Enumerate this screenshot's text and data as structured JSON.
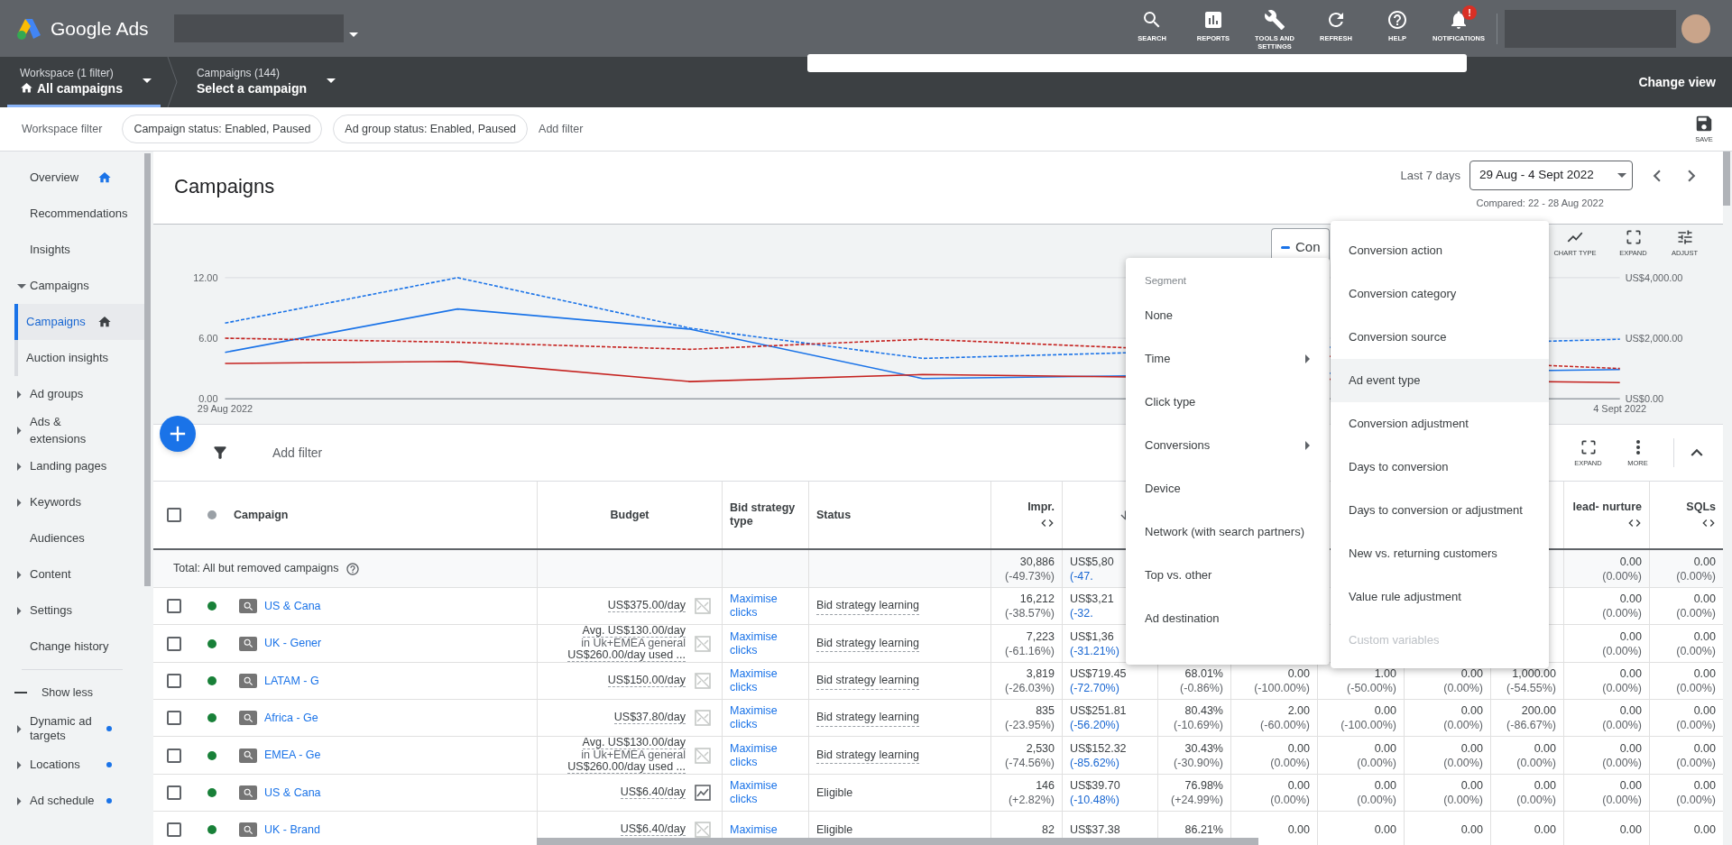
{
  "app": {
    "title": "Google Ads"
  },
  "top_actions": [
    {
      "label": "SEARCH",
      "kind": "search"
    },
    {
      "label": "REPORTS",
      "kind": "reports"
    },
    {
      "label": "TOOLS AND SETTINGS",
      "kind": "tools"
    },
    {
      "label": "REFRESH",
      "kind": "refresh"
    },
    {
      "label": "HELP",
      "kind": "help"
    },
    {
      "label": "NOTIFICATIONS",
      "kind": "notifications",
      "badge": "!"
    }
  ],
  "breadcrumbs": [
    {
      "caption": "Workspace (1 filter)",
      "title": "All campaigns",
      "home": true,
      "selected": true
    },
    {
      "caption": "Campaigns (144)",
      "title": "Select a campaign",
      "home": false,
      "selected": false
    }
  ],
  "change_view": "Change view",
  "filter_bar": {
    "label": "Workspace filter",
    "chips": [
      "Campaign status: Enabled, Paused",
      "Ad group status: Enabled, Paused"
    ],
    "add_filter": "Add filter",
    "save": "SAVE"
  },
  "sidebar": {
    "items": [
      {
        "label": "Overview",
        "home": true,
        "selected": false
      },
      {
        "label": "Recommendations",
        "selected": false
      },
      {
        "label": "Insights",
        "selected": false
      },
      {
        "label": "Campaigns",
        "expanded": true,
        "selected": false,
        "children": [
          {
            "label": "Campaigns",
            "home": true,
            "selected": true
          },
          {
            "label": "Auction insights",
            "selected": false
          }
        ]
      },
      {
        "label": "Ad groups",
        "expanded": false,
        "selected": false
      },
      {
        "label": "Ads & extensions",
        "expanded": false,
        "selected": false
      },
      {
        "label": "Landing pages",
        "expanded": false,
        "selected": false
      },
      {
        "label": "Keywords",
        "expanded": false,
        "selected": false
      },
      {
        "label": "Audiences",
        "selected": false
      },
      {
        "label": "Content",
        "expanded": false,
        "selected": false
      },
      {
        "label": "Settings",
        "expanded": false,
        "selected": false
      },
      {
        "label": "Change history",
        "selected": false
      }
    ],
    "show_less": "Show less",
    "more_items": [
      {
        "label": "Dynamic ad targets",
        "expanded": false,
        "dot": true
      },
      {
        "label": "Locations",
        "expanded": false,
        "dot": true
      },
      {
        "label": "Ad schedule",
        "expanded": false,
        "dot": true
      }
    ]
  },
  "page": {
    "title": "Campaigns",
    "range_label": "Last 7 days",
    "date_range": "29 Aug - 4 Sept 2022",
    "compared": "Compared: 22 - 28 Aug 2022"
  },
  "chart": {
    "legend_label": "Con",
    "tools": [
      {
        "label": "CHART TYPE",
        "kind": "chart_type"
      },
      {
        "label": "EXPAND",
        "kind": "expand"
      },
      {
        "label": "ADJUST",
        "kind": "adjust"
      }
    ],
    "right_axis_labels": [
      "US$4,000.00",
      "US$2,000.00",
      "US$0.00"
    ],
    "chart_data": {
      "type": "line",
      "categories": [
        "29 Aug 2022",
        null,
        null,
        null,
        null,
        null,
        "4 Sept 2022"
      ],
      "ylim": [
        0,
        12
      ],
      "yticks": [
        {
          "value": 0,
          "label": "0.00"
        },
        {
          "value": 6,
          "label": "6.00"
        },
        {
          "value": 12,
          "label": "12.00"
        }
      ],
      "series": [
        {
          "color": "#1a73e8",
          "line_style": "dashed",
          "values": [
            7.5,
            12,
            7.0,
            4.0,
            null,
            null,
            5.9
          ]
        },
        {
          "color": "#1a73e8",
          "line_style": "solid",
          "values": [
            4.6,
            8.9,
            6.9,
            2.0,
            null,
            null,
            2.9
          ]
        },
        {
          "color": "#c5221f",
          "line_style": "dashed",
          "values": [
            6.0,
            5.6,
            4.9,
            5.9,
            null,
            null,
            3.0
          ]
        },
        {
          "color": "#c5221f",
          "line_style": "solid",
          "values": [
            3.5,
            3.7,
            1.7,
            2.4,
            null,
            null,
            1.6
          ]
        }
      ]
    }
  },
  "table_toolbar": {
    "add_filter": "Add filter",
    "tools": [
      {
        "label": "EXPAND",
        "kind": "expand"
      },
      {
        "label": "MORE",
        "kind": "more"
      }
    ]
  },
  "table": {
    "header_checked": false,
    "headers": {
      "campaign": {
        "label": "Campaign"
      },
      "budget": {
        "label": "Budget"
      },
      "bid_strategy": {
        "label": "Bid strategy type"
      },
      "status": {
        "label": "Status"
      },
      "impr": {
        "label": "Impr.",
        "sortable": true
      },
      "cost": {
        "sorted": true
      },
      "lead_nurture": {
        "label": "lead- nurture",
        "sortable": true
      },
      "sqls": {
        "label": "SQLs",
        "sortable": true
      }
    },
    "total": {
      "label": "Total: All but removed campaigns",
      "metrics": {
        "impr": [
          "30,886",
          "(-49.73%)"
        ],
        "cost": [
          "US$5,80",
          "(-47."
        ],
        "lead_nurture": [
          "0.00",
          "(0.00%)"
        ],
        "sqls": [
          "0.00",
          "(0.00%)"
        ]
      }
    },
    "rows": [
      {
        "checked": false,
        "color": "#188038",
        "name": "US & Cana",
        "budget": [
          "US$375.00/day"
        ],
        "budget_chart": false,
        "bid_strategy": "Maximise clicks",
        "status": "Bid strategy learning",
        "status_hint": true,
        "metrics": {
          "impr": [
            "16,212",
            "(-38.57%)"
          ],
          "cost": [
            "US$3,21",
            "(-32."
          ],
          "lead_nurture": [
            "0.00",
            "(0.00%)"
          ],
          "sqls": [
            "0.00",
            "(0.00%)"
          ]
        }
      },
      {
        "checked": false,
        "color": "#188038",
        "name": "UK - Gener",
        "budget": [
          "Avg. US$130.00/day",
          "in Uk+EMEA general",
          "US$260.00/day used ..."
        ],
        "budget_chart": false,
        "bid_strategy": "Maximise clicks",
        "status": "Bid strategy learning",
        "status_hint": true,
        "metrics": {
          "impr": [
            "7,223",
            "(-61.16%)"
          ],
          "cost": [
            "US$1,36",
            "(-31.21%)"
          ],
          "lead_nurture": [
            "0.00",
            "(0.00%)"
          ],
          "sqls": [
            "0.00",
            "(0.00%)"
          ]
        }
      },
      {
        "checked": false,
        "color": "#188038",
        "name": "LATAM - G",
        "budget": [
          "US$150.00/day"
        ],
        "budget_chart": false,
        "bid_strategy": "Maximise clicks",
        "status": "Bid strategy learning",
        "status_hint": true,
        "metrics": {
          "impr": [
            "3,819",
            "(-26.03%)"
          ],
          "cost": [
            "US$719.45",
            "(-72.70%)"
          ],
          "column_8": [
            "68.01%",
            "(-0.86%)"
          ],
          "column_9": [
            "0.00",
            "(-100.00%)"
          ],
          "column_10": [
            "1.00",
            "(-50.00%)"
          ],
          "column_11": [
            "0.00",
            "(0.00%)"
          ],
          "column_12": [
            "1,000.00",
            "(-54.55%)"
          ],
          "lead_nurture": [
            "0.00",
            "(0.00%)"
          ],
          "sqls": [
            "0.00",
            "(0.00%)"
          ]
        }
      },
      {
        "checked": false,
        "color": "#188038",
        "name": "Africa - Ge",
        "budget": [
          "US$37.80/day"
        ],
        "budget_chart": false,
        "bid_strategy": "Maximise clicks",
        "status": "Bid strategy learning",
        "status_hint": true,
        "metrics": {
          "impr": [
            "835",
            "(-23.95%)"
          ],
          "cost": [
            "US$251.81",
            "(-56.20%)"
          ],
          "column_8": [
            "80.43%",
            "(-10.69%)"
          ],
          "column_9": [
            "2.00",
            "(-60.00%)"
          ],
          "column_10": [
            "0.00",
            "(-100.00%)"
          ],
          "column_11": [
            "0.00",
            "(0.00%)"
          ],
          "column_12": [
            "200.00",
            "(-86.67%)"
          ],
          "lead_nurture": [
            "0.00",
            "(0.00%)"
          ],
          "sqls": [
            "0.00",
            "(0.00%)"
          ]
        }
      },
      {
        "checked": false,
        "color": "#188038",
        "name": "EMEA - Ge",
        "budget": [
          "Avg. US$130.00/day",
          "in Uk+EMEA general",
          "US$260.00/day used ..."
        ],
        "budget_chart": false,
        "bid_strategy": "Maximise clicks",
        "status": "Bid strategy learning",
        "status_hint": true,
        "metrics": {
          "impr": [
            "2,530",
            "(-74.56%)"
          ],
          "cost": [
            "US$152.32",
            "(-85.62%)"
          ],
          "column_8": [
            "30.43%",
            "(-30.90%)"
          ],
          "column_9": [
            "0.00",
            "(0.00%)"
          ],
          "column_10": [
            "0.00",
            "(0.00%)"
          ],
          "column_11": [
            "0.00",
            "(0.00%)"
          ],
          "column_12": [
            "0.00",
            "(0.00%)"
          ],
          "lead_nurture": [
            "0.00",
            "(0.00%)"
          ],
          "sqls": [
            "0.00",
            "(0.00%)"
          ]
        }
      },
      {
        "checked": false,
        "color": "#188038",
        "name": "US & Cana",
        "budget": [
          "US$6.40/day"
        ],
        "budget_chart": true,
        "bid_strategy": "Maximise clicks",
        "status": "Eligible",
        "status_hint": false,
        "metrics": {
          "impr": [
            "146",
            "(+2.82%)"
          ],
          "cost": [
            "US$39.70",
            "(-10.48%)"
          ],
          "column_8": [
            "76.98%",
            "(+24.99%)"
          ],
          "column_9": [
            "0.00",
            "(0.00%)"
          ],
          "column_10": [
            "0.00",
            "(0.00%)"
          ],
          "column_11": [
            "0.00",
            "(0.00%)"
          ],
          "column_12": [
            "0.00",
            "(0.00%)"
          ],
          "lead_nurture": [
            "0.00",
            "(0.00%)"
          ],
          "sqls": [
            "0.00",
            "(0.00%)"
          ]
        }
      },
      {
        "checked": false,
        "color": "#188038",
        "name": "UK - Brand",
        "budget": [
          "US$6.40/day"
        ],
        "budget_chart": false,
        "bid_strategy": "Maximise",
        "status": "Eligible",
        "status_hint": false,
        "metrics": {
          "impr": [
            "82"
          ],
          "cost": [
            "US$37.38"
          ],
          "column_8": [
            "86.21%"
          ],
          "column_9": [
            "0.00"
          ],
          "column_10": [
            "0.00"
          ],
          "column_11": [
            "0.00"
          ],
          "column_12": [
            "0.00"
          ],
          "lead_nurture": [
            "0.00"
          ],
          "sqls": [
            "0.00"
          ]
        }
      }
    ]
  },
  "segment_menu": {
    "heading": "Segment",
    "items": [
      {
        "label": "None",
        "submenu": false
      },
      {
        "label": "Time",
        "submenu": true
      },
      {
        "label": "Click type",
        "submenu": false
      },
      {
        "label": "Conversions",
        "submenu": true
      },
      {
        "label": "Device",
        "submenu": false
      },
      {
        "label": "Network (with search partners)",
        "submenu": false
      },
      {
        "label": "Top vs. other",
        "submenu": false
      },
      {
        "label": "Ad destination",
        "submenu": false
      }
    ]
  },
  "conversions_submenu": {
    "items": [
      {
        "label": "Conversion action",
        "highlighted": false,
        "disabled": false
      },
      {
        "label": "Conversion category",
        "highlighted": false,
        "disabled": false
      },
      {
        "label": "Conversion source",
        "highlighted": false,
        "disabled": false
      },
      {
        "label": "Ad event type",
        "highlighted": true,
        "disabled": false
      },
      {
        "label": "Conversion adjustment",
        "highlighted": false,
        "disabled": false
      },
      {
        "label": "Days to conversion",
        "highlighted": false,
        "disabled": false
      },
      {
        "label": "Days to conversion or adjustment",
        "highlighted": false,
        "disabled": false
      },
      {
        "label": "New vs. returning customers",
        "highlighted": false,
        "disabled": false
      },
      {
        "label": "Value rule adjustment",
        "highlighted": false,
        "disabled": false
      },
      {
        "label": "Custom variables",
        "highlighted": false,
        "disabled": true
      }
    ]
  }
}
